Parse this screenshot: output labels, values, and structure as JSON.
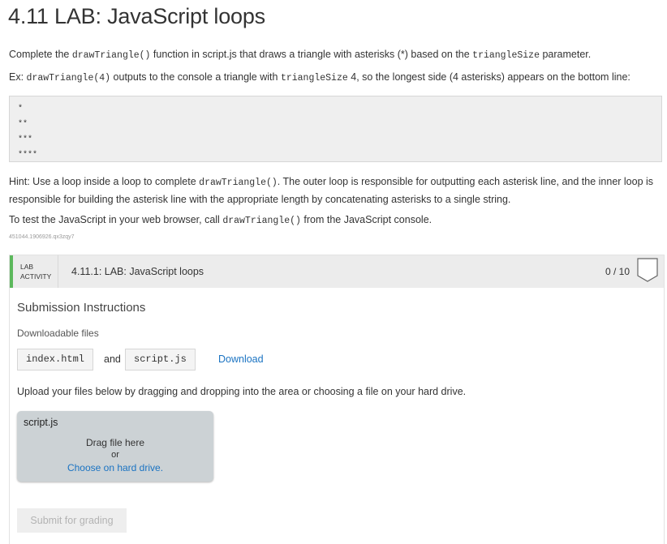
{
  "page": {
    "title": "4.11 LAB: JavaScript loops"
  },
  "intro": {
    "p1_before": "Complete the ",
    "p1_code1": "drawTriangle()",
    "p1_mid": " function in script.js that draws a triangle with asterisks (*) based on the ",
    "p1_code2": "triangleSize",
    "p1_after": " parameter.",
    "p2_before": "Ex: ",
    "p2_code1": "drawTriangle(4)",
    "p2_mid": " outputs to the console a triangle with ",
    "p2_code2": "triangleSize",
    "p2_after": " 4, so the longest side (4 asterisks) appears on the bottom line:",
    "example_output": "*\n**\n***\n****",
    "p3_before": "Hint: Use a loop inside a loop to complete ",
    "p3_code": "drawTriangle()",
    "p3_after": ". The outer loop is responsible for outputting each asterisk line, and the inner loop is responsible for building the asterisk line with the appropriate length by concatenating asterisks to a single string.",
    "p4_before": "To test the JavaScript in your web browser, call ",
    "p4_code": "drawTriangle()",
    "p4_after": " from the JavaScript console.",
    "tag": "451044.1906926.qx3zqy7"
  },
  "lab": {
    "badge_line1": "LAB",
    "badge_line2": "ACTIVITY",
    "title": "4.11.1: LAB: JavaScript loops",
    "score": "0 / 10",
    "submission_title": "Submission Instructions",
    "downloadable_label": "Downloadable files",
    "file1": "index.html",
    "and_text": "and",
    "file2": "script.js",
    "download_label": "Download",
    "upload_text": "Upload your files below by dragging and dropping into the area or choosing a file on your hard drive.",
    "dropzone": {
      "filename": "script.js",
      "drag_text": "Drag file here",
      "or_text": "or",
      "choose_text": "Choose on hard drive."
    },
    "submit_label": "Submit for grading"
  }
}
